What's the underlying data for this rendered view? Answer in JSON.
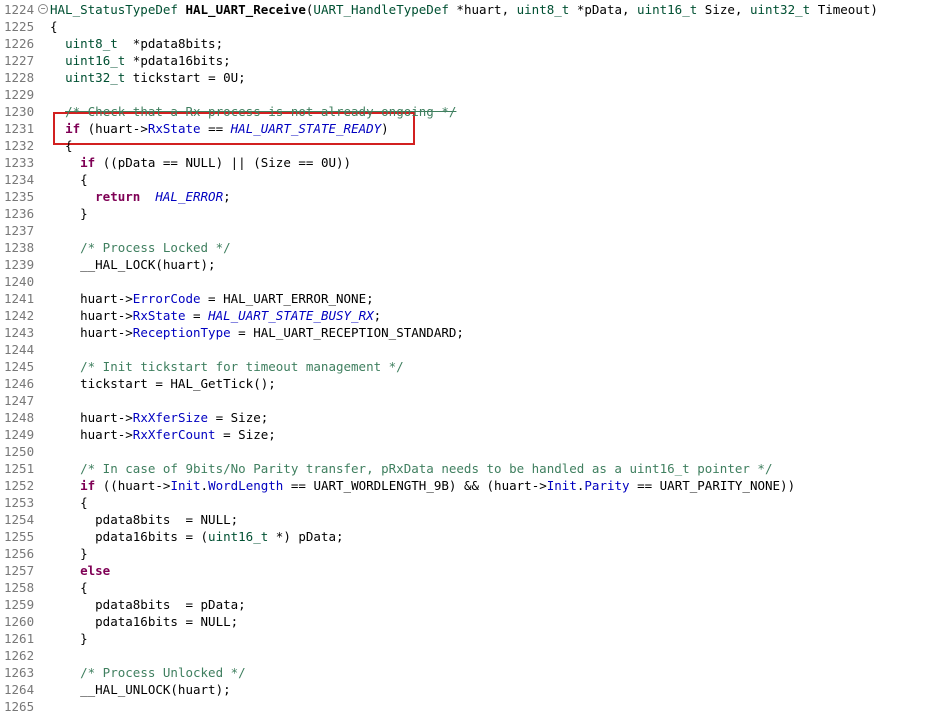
{
  "editor": {
    "lines": [
      {
        "n": "1224",
        "fold": "⊖",
        "code": [
          {
            "t": "HAL_StatusTypeDef ",
            "c": "t"
          },
          {
            "t": "HAL_UART_Receive",
            "c": "f"
          },
          {
            "t": "(",
            "c": ""
          },
          {
            "t": "UART_HandleTypeDef",
            "c": "t"
          },
          {
            "t": " *huart, ",
            "c": ""
          },
          {
            "t": "uint8_t",
            "c": "t"
          },
          {
            "t": " *pData, ",
            "c": ""
          },
          {
            "t": "uint16_t",
            "c": "t"
          },
          {
            "t": " Size, ",
            "c": ""
          },
          {
            "t": "uint32_t",
            "c": "t"
          },
          {
            "t": " Timeout)",
            "c": ""
          }
        ]
      },
      {
        "n": "1225",
        "code": [
          {
            "t": "{",
            "c": ""
          }
        ]
      },
      {
        "n": "1226",
        "code": [
          {
            "t": "  ",
            "c": ""
          },
          {
            "t": "uint8_t",
            "c": "t"
          },
          {
            "t": "  *pdata8bits;",
            "c": ""
          }
        ]
      },
      {
        "n": "1227",
        "code": [
          {
            "t": "  ",
            "c": ""
          },
          {
            "t": "uint16_t",
            "c": "t"
          },
          {
            "t": " *pdata16bits;",
            "c": ""
          }
        ]
      },
      {
        "n": "1228",
        "code": [
          {
            "t": "  ",
            "c": ""
          },
          {
            "t": "uint32_t",
            "c": "t"
          },
          {
            "t": " tickstart = 0U;",
            "c": ""
          }
        ]
      },
      {
        "n": "1229",
        "code": []
      },
      {
        "n": "1230",
        "code": [
          {
            "t": "  ",
            "c": ""
          },
          {
            "t": "/* Check that a Rx process is not already ongoing */",
            "c": "c strike"
          }
        ]
      },
      {
        "n": "1231",
        "code": [
          {
            "t": "  ",
            "c": ""
          },
          {
            "t": "if",
            "c": "k"
          },
          {
            "t": " (huart->",
            "c": ""
          },
          {
            "t": "RxState",
            "c": "m"
          },
          {
            "t": " == ",
            "c": ""
          },
          {
            "t": "HAL_UART_STATE_READY",
            "c": "e"
          },
          {
            "t": ")",
            "c": ""
          }
        ]
      },
      {
        "n": "1232",
        "code": [
          {
            "t": "  {",
            "c": ""
          }
        ]
      },
      {
        "n": "1233",
        "code": [
          {
            "t": "    ",
            "c": ""
          },
          {
            "t": "if",
            "c": "k"
          },
          {
            "t": " ((pData == NULL) || (Size == 0U))",
            "c": ""
          }
        ]
      },
      {
        "n": "1234",
        "code": [
          {
            "t": "    {",
            "c": ""
          }
        ]
      },
      {
        "n": "1235",
        "code": [
          {
            "t": "      ",
            "c": ""
          },
          {
            "t": "return",
            "c": "k"
          },
          {
            "t": "  ",
            "c": ""
          },
          {
            "t": "HAL_ERROR",
            "c": "e"
          },
          {
            "t": ";",
            "c": ""
          }
        ]
      },
      {
        "n": "1236",
        "code": [
          {
            "t": "    }",
            "c": ""
          }
        ]
      },
      {
        "n": "1237",
        "code": []
      },
      {
        "n": "1238",
        "code": [
          {
            "t": "    ",
            "c": ""
          },
          {
            "t": "/* Process Locked */",
            "c": "c"
          }
        ]
      },
      {
        "n": "1239",
        "code": [
          {
            "t": "    __HAL_LOCK(huart);",
            "c": ""
          }
        ]
      },
      {
        "n": "1240",
        "code": []
      },
      {
        "n": "1241",
        "code": [
          {
            "t": "    huart->",
            "c": ""
          },
          {
            "t": "ErrorCode",
            "c": "m"
          },
          {
            "t": " = HAL_UART_ERROR_NONE;",
            "c": ""
          }
        ]
      },
      {
        "n": "1242",
        "code": [
          {
            "t": "    huart->",
            "c": ""
          },
          {
            "t": "RxState",
            "c": "m"
          },
          {
            "t": " = ",
            "c": ""
          },
          {
            "t": "HAL_UART_STATE_BUSY_RX",
            "c": "e"
          },
          {
            "t": ";",
            "c": ""
          }
        ]
      },
      {
        "n": "1243",
        "code": [
          {
            "t": "    huart->",
            "c": ""
          },
          {
            "t": "ReceptionType",
            "c": "m"
          },
          {
            "t": " = HAL_UART_RECEPTION_STANDARD;",
            "c": ""
          }
        ]
      },
      {
        "n": "1244",
        "code": []
      },
      {
        "n": "1245",
        "code": [
          {
            "t": "    ",
            "c": ""
          },
          {
            "t": "/* Init tickstart for timeout management */",
            "c": "c"
          }
        ]
      },
      {
        "n": "1246",
        "code": [
          {
            "t": "    tickstart = HAL_GetTick();",
            "c": ""
          }
        ]
      },
      {
        "n": "1247",
        "code": []
      },
      {
        "n": "1248",
        "code": [
          {
            "t": "    huart->",
            "c": ""
          },
          {
            "t": "RxXferSize",
            "c": "m"
          },
          {
            "t": " = Size;",
            "c": ""
          }
        ]
      },
      {
        "n": "1249",
        "code": [
          {
            "t": "    huart->",
            "c": ""
          },
          {
            "t": "RxXferCount",
            "c": "m"
          },
          {
            "t": " = Size;",
            "c": ""
          }
        ]
      },
      {
        "n": "1250",
        "code": []
      },
      {
        "n": "1251",
        "code": [
          {
            "t": "    ",
            "c": ""
          },
          {
            "t": "/* In case of 9bits/No Parity transfer, pRxData needs to be handled as a uint16_t pointer */",
            "c": "c"
          }
        ]
      },
      {
        "n": "1252",
        "code": [
          {
            "t": "    ",
            "c": ""
          },
          {
            "t": "if",
            "c": "k"
          },
          {
            "t": " ((huart->",
            "c": ""
          },
          {
            "t": "Init",
            "c": "m"
          },
          {
            "t": ".",
            "c": ""
          },
          {
            "t": "WordLength",
            "c": "m"
          },
          {
            "t": " == UART_WORDLENGTH_9B) && (huart->",
            "c": ""
          },
          {
            "t": "Init",
            "c": "m"
          },
          {
            "t": ".",
            "c": ""
          },
          {
            "t": "Parity",
            "c": "m"
          },
          {
            "t": " == UART_PARITY_NONE))",
            "c": ""
          }
        ]
      },
      {
        "n": "1253",
        "code": [
          {
            "t": "    {",
            "c": ""
          }
        ]
      },
      {
        "n": "1254",
        "code": [
          {
            "t": "      pdata8bits  = NULL;",
            "c": ""
          }
        ]
      },
      {
        "n": "1255",
        "code": [
          {
            "t": "      pdata16bits = (",
            "c": ""
          },
          {
            "t": "uint16_t",
            "c": "t"
          },
          {
            "t": " *) pData;",
            "c": ""
          }
        ]
      },
      {
        "n": "1256",
        "code": [
          {
            "t": "    }",
            "c": ""
          }
        ]
      },
      {
        "n": "1257",
        "code": [
          {
            "t": "    ",
            "c": ""
          },
          {
            "t": "else",
            "c": "k"
          }
        ]
      },
      {
        "n": "1258",
        "code": [
          {
            "t": "    {",
            "c": ""
          }
        ]
      },
      {
        "n": "1259",
        "code": [
          {
            "t": "      pdata8bits  = pData;",
            "c": ""
          }
        ]
      },
      {
        "n": "1260",
        "code": [
          {
            "t": "      pdata16bits = NULL;",
            "c": ""
          }
        ]
      },
      {
        "n": "1261",
        "code": [
          {
            "t": "    }",
            "c": ""
          }
        ]
      },
      {
        "n": "1262",
        "code": []
      },
      {
        "n": "1263",
        "code": [
          {
            "t": "    ",
            "c": ""
          },
          {
            "t": "/* Process Unlocked */",
            "c": "c"
          }
        ]
      },
      {
        "n": "1264",
        "code": [
          {
            "t": "    __HAL_UNLOCK(huart);",
            "c": ""
          }
        ]
      },
      {
        "n": "1265",
        "code": []
      }
    ]
  }
}
